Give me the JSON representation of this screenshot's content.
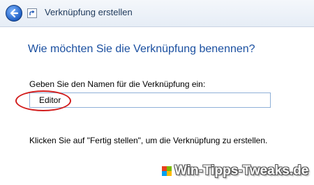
{
  "window": {
    "title": "Verknüpfung erstellen",
    "back_icon": "back-arrow-icon",
    "shortcut_icon": "shortcut-icon"
  },
  "main": {
    "heading": "Wie möchten Sie die Verknüpfung benennen?",
    "name_label": "Geben Sie den Namen für die Verknüpfung ein:",
    "name_value": "Editor",
    "instruction": "Klicken Sie auf \"Fertig stellen\", um die Verknüpfung zu erstellen."
  },
  "annotation": {
    "highlight_color": "#d21d1d"
  },
  "watermark": {
    "text": "Win-Tipps-Tweaks.de",
    "logo_colors": [
      "#e8401c",
      "#7cbb00",
      "#00a1f1",
      "#ffbb00"
    ]
  }
}
